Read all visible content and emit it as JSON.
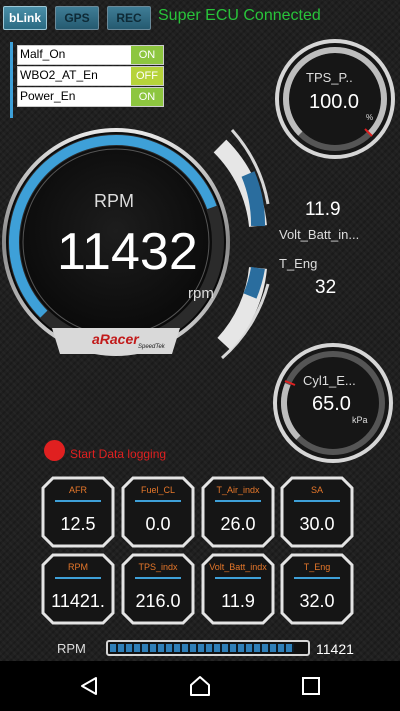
{
  "topbar": {
    "buttons": [
      {
        "label": "bLink",
        "active": true
      },
      {
        "label": "GPS",
        "active": false
      },
      {
        "label": "REC",
        "active": false
      }
    ],
    "status": "Super ECU Connected"
  },
  "switches": [
    {
      "label": "Malf_On",
      "value": "ON"
    },
    {
      "label": "WBO2_AT_En",
      "value": "OFF"
    },
    {
      "label": "Power_En",
      "value": "ON"
    }
  ],
  "main_gauge": {
    "title": "RPM",
    "value": "11432",
    "unit": "rpm",
    "logo": "aRacer",
    "logo_sub": "SpeedTek",
    "fill_fraction": 0.76
  },
  "tps_gauge": {
    "title": "TPS_P..",
    "value": "100.0",
    "unit": "%",
    "fill_fraction": 1.0
  },
  "side_readouts": [
    {
      "label": "Volt_Batt_in...",
      "value": "11.9"
    },
    {
      "label": "T_Eng",
      "value": "32"
    }
  ],
  "cyl_gauge": {
    "title": "Cyl1_E...",
    "value": "65.0",
    "unit": "kPa",
    "fill_fraction": 0.25
  },
  "logging": {
    "label": "Start Data logging"
  },
  "tiles": [
    {
      "label": "AFR",
      "value": "12.5"
    },
    {
      "label": "Fuel_CL",
      "value": "0.0"
    },
    {
      "label": "T_Air_indx",
      "value": "26.0"
    },
    {
      "label": "SA",
      "value": "30.0"
    },
    {
      "label": "RPM",
      "value": "11421."
    },
    {
      "label": "TPS_indx",
      "value": "216.0"
    },
    {
      "label": "Volt_Batt_indx",
      "value": "11.9"
    },
    {
      "label": "T_Eng",
      "value": "32.0"
    }
  ],
  "bottom_bar": {
    "label": "RPM",
    "value": "11421",
    "fill_fraction": 0.94
  },
  "colors": {
    "accent_blue": "#3ea0d8",
    "status_green": "#28c43a",
    "tile_label": "#e6772a",
    "record_red": "#e02020"
  },
  "nav_icons": [
    "back-icon",
    "home-icon",
    "recents-icon"
  ]
}
